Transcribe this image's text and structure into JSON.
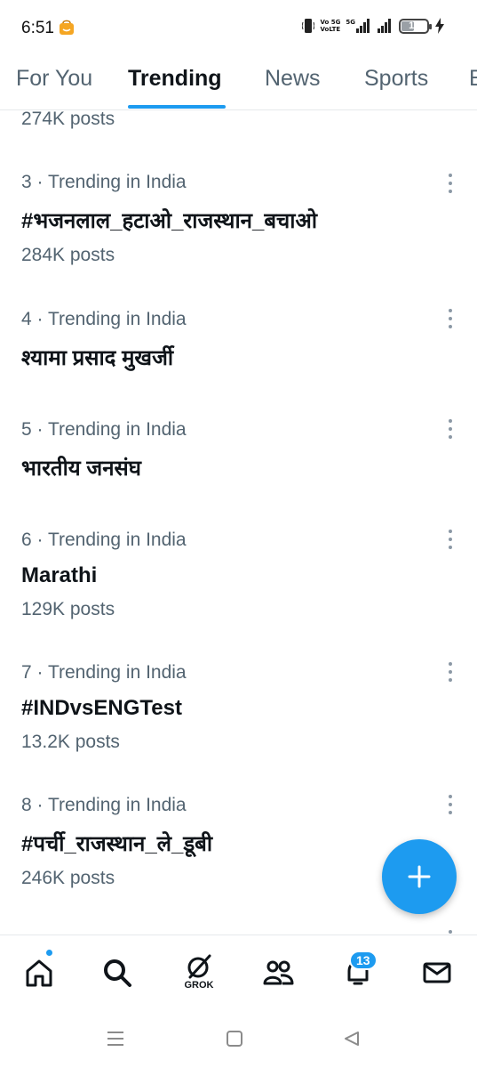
{
  "status_bar": {
    "time": "6:51",
    "network_labels": [
      "Vo 5G",
      "VoLTE",
      "5G"
    ],
    "battery_level": "11",
    "battery_fraction": 0.11
  },
  "tabs": [
    {
      "label": "For You",
      "active": false
    },
    {
      "label": "Trending",
      "active": true
    },
    {
      "label": "News",
      "active": false
    },
    {
      "label": "Sports",
      "active": false
    },
    {
      "label": "E",
      "active": false
    }
  ],
  "feed": {
    "partial_top_posts": "274K posts",
    "trends": [
      {
        "meta": "3 · Trending in India",
        "title": "#भजनलाल_हटाओ_राजस्थान_बचाओ",
        "posts": "284K posts"
      },
      {
        "meta": "4 · Trending in India",
        "title": "श्यामा प्रसाद मुखर्जी",
        "posts": ""
      },
      {
        "meta": "5 · Trending in India",
        "title": "भारतीय जनसंघ",
        "posts": ""
      },
      {
        "meta": "6 · Trending in India",
        "title": "Marathi",
        "posts": "129K posts"
      },
      {
        "meta": "7 · Trending in India",
        "title": "#INDvsENGTest",
        "posts": "13.2K posts"
      },
      {
        "meta": "8 · Trending in India",
        "title": "#पर्ची_राजस्थान_ले_डूबी",
        "posts": "246K posts"
      }
    ]
  },
  "fab": {
    "icon": "plus-icon"
  },
  "bottom_nav": {
    "items": [
      {
        "name": "home",
        "icon": "home-icon"
      },
      {
        "name": "search",
        "icon": "search-icon"
      },
      {
        "name": "grok",
        "icon": "grok-icon",
        "label": "GROK"
      },
      {
        "name": "communities",
        "icon": "people-icon"
      },
      {
        "name": "notifications",
        "icon": "bell-icon"
      },
      {
        "name": "messages",
        "icon": "mail-icon"
      }
    ],
    "notification_count": "13"
  },
  "system_nav": {
    "icons": [
      "menu-icon",
      "home-square-icon",
      "back-triangle-icon"
    ]
  },
  "colors": {
    "accent": "#1d9bf0",
    "secondary_text": "#536471",
    "primary_text": "#0f1419"
  }
}
